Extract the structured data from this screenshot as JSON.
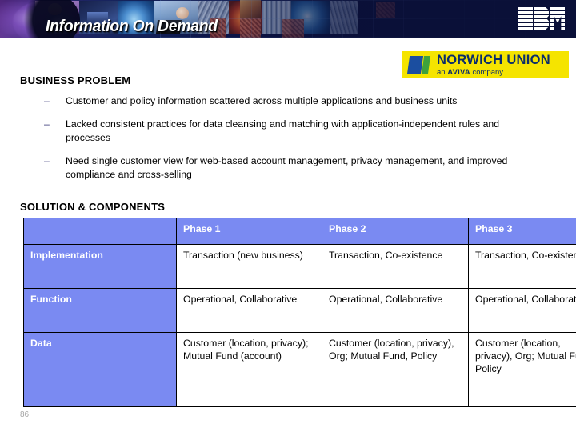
{
  "banner": {
    "title": "Information On Demand",
    "brand": "IBM",
    "background_color": "#0a1038"
  },
  "partner_logo": {
    "name": "NORWICH UNION",
    "tagline_prefix": "an ",
    "tagline_brand": "AVIVA",
    "tagline_suffix": " company",
    "background_color": "#f5e400",
    "text_color": "#0b2d6b"
  },
  "sections": {
    "business_problem": {
      "heading": "BUSINESS PROBLEM",
      "bullet_marker": "–",
      "bullets": [
        "Customer and policy information scattered across multiple applications and business units",
        "Lacked consistent practices for data cleansing and matching with application-independent rules and processes",
        "Need single customer view for web-based account management, privacy management, and improved compliance and cross-selling"
      ]
    },
    "solution_components": {
      "heading": "SOLUTION & COMPONENTS",
      "table": {
        "accent_color": "#7a8af2",
        "headers": [
          "",
          "Phase 1",
          "Phase 2",
          "Phase 3"
        ],
        "rows": [
          {
            "label": "Implementation",
            "cells": [
              "Transaction (new business)",
              "Transaction, Co-existence",
              "Transaction, Co-existence"
            ]
          },
          {
            "label": "Function",
            "cells": [
              "Operational, Collaborative",
              "Operational, Collaborative",
              "Operational, Collaborative"
            ]
          },
          {
            "label": "Data",
            "cells": [
              "Customer (location, privacy); Mutual Fund (account)",
              "Customer (location, privacy), Org; Mutual Fund, Policy",
              "Customer (location, privacy), Org; Mutual Fund, Policy"
            ]
          }
        ]
      }
    }
  },
  "footer": {
    "page_number": "86"
  }
}
